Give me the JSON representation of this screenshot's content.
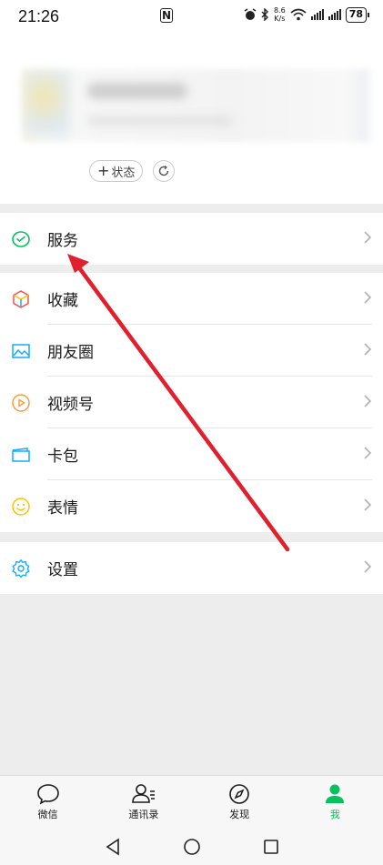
{
  "status_bar": {
    "time": "21:26",
    "nfc": "N",
    "speed_value": "8.6",
    "speed_unit": "K/s",
    "battery": "78"
  },
  "profile": {
    "status_chip_label": "状态",
    "status_chip_plus": "+"
  },
  "menu": {
    "group1": [
      {
        "label": "服务",
        "icon": "wechat-pay-icon"
      }
    ],
    "group2": [
      {
        "label": "收藏",
        "icon": "favorites-cube-icon"
      },
      {
        "label": "朋友圈",
        "icon": "moments-photo-icon"
      },
      {
        "label": "视频号",
        "icon": "channels-play-icon"
      },
      {
        "label": "卡包",
        "icon": "card-wallet-icon"
      },
      {
        "label": "表情",
        "icon": "sticker-smiley-icon"
      }
    ],
    "group3": [
      {
        "label": "设置",
        "icon": "settings-gear-icon"
      }
    ]
  },
  "tabbar": {
    "tabs": [
      {
        "label": "微信",
        "icon": "chat-bubble-icon",
        "active": false
      },
      {
        "label": "通讯录",
        "icon": "contacts-icon",
        "active": false
      },
      {
        "label": "发现",
        "icon": "compass-icon",
        "active": false
      },
      {
        "label": "我",
        "icon": "person-icon",
        "active": true
      }
    ]
  },
  "colors": {
    "accent_green": "#07c160",
    "annotation_red": "#e0202c",
    "background": "#ededed"
  }
}
